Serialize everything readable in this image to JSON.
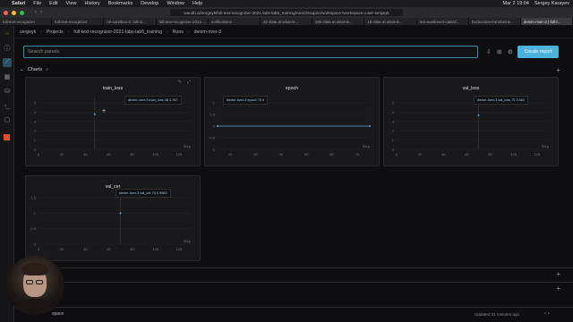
{
  "menubar": {
    "app": "Safari",
    "items": [
      "File",
      "Edit",
      "View",
      "History",
      "Bookmarks",
      "Develop",
      "Window",
      "Help"
    ],
    "clock": "Mar 2 19:04",
    "user": "Sergey Karayev"
  },
  "browser": {
    "url": "wandb.ai/sergeyk/full-text-recognizer-2021-labs-lab5_training/runs/3rxup2o/workspace?workspace=user-sergeyk",
    "tabs": [
      "full-text-recognizer",
      "full-text-recognizer",
      "ml-sandbox-2: full-to...",
      "full-text-recognizer-2021-...",
      "notifications",
      "23 slate at what-le...",
      "20k slate at what-le...",
      "15 slate at what-le...",
      "text-sentiment-classif..",
      "Exclusions-transforme...",
      "denim-river-3 | full-t..."
    ],
    "active_tab": 10
  },
  "breadcrumb": [
    "sergeyk",
    "Projects",
    "full-text-recognizer-2021-labs-lab5_training",
    "Runs",
    "denim-river-3"
  ],
  "search": {
    "placeholder": "Search panels"
  },
  "create_report": "Create report",
  "section": {
    "name": "Charts",
    "count": "4"
  },
  "panels": [
    {
      "title": "train_loss",
      "tooltip": "denim-river-3 train_loss 48  3.782",
      "xlabel": "Step",
      "xticks": [
        "0",
        "20",
        "40",
        "60",
        "80",
        "100",
        "120"
      ],
      "yticks": [
        "5",
        "4",
        "3",
        "2",
        "1",
        "0"
      ]
    },
    {
      "title": "epoch",
      "tooltip": "denim-river-3 epoch 70  0",
      "xlabel": "Step",
      "xticks": [
        "20",
        "30",
        "40",
        "50",
        "60",
        "70"
      ],
      "yticks": [
        "1",
        "0.5",
        "0",
        "-0.5",
        "-1"
      ]
    },
    {
      "title": "val_loss",
      "tooltip": "denim-river-3 val_loss 70  3.661",
      "xlabel": "Step",
      "xticks": [
        "0",
        "20",
        "40",
        "60",
        "80",
        "100",
        "120"
      ],
      "yticks": [
        "5",
        "4",
        "3",
        "2",
        "1",
        "0"
      ]
    },
    {
      "title": "val_cer",
      "tooltip": "denim-river-3 val_cer 70  0.9983",
      "xlabel": "Step",
      "xticks": [
        "0",
        "20",
        "40",
        "60",
        "80",
        "100",
        "120"
      ],
      "yticks": [
        "1.5",
        "1",
        "0.5",
        "0"
      ]
    }
  ],
  "chart_data": [
    {
      "type": "line",
      "title": "train_loss",
      "xlabel": "Step",
      "xlim": [
        0,
        130
      ],
      "ylim": [
        0,
        5
      ],
      "series": [
        {
          "name": "denim-river-3",
          "x": [
            48
          ],
          "y": [
            3.782
          ]
        }
      ]
    },
    {
      "type": "line",
      "title": "epoch",
      "xlabel": "Step",
      "xlim": [
        15,
        75
      ],
      "ylim": [
        -1,
        1
      ],
      "series": [
        {
          "name": "denim-river-3",
          "x": [
            15,
            75
          ],
          "y": [
            0,
            0
          ]
        }
      ]
    },
    {
      "type": "line",
      "title": "val_loss",
      "xlabel": "Step",
      "xlim": [
        0,
        130
      ],
      "ylim": [
        0,
        5
      ],
      "series": [
        {
          "name": "denim-river-3",
          "x": [
            70
          ],
          "y": [
            3.661
          ]
        }
      ]
    },
    {
      "type": "line",
      "title": "val_cer",
      "xlabel": "Step",
      "xlim": [
        0,
        130
      ],
      "ylim": [
        0,
        1.5
      ],
      "series": [
        {
          "name": "denim-river-3",
          "x": [
            70
          ],
          "y": [
            0.9983
          ]
        }
      ]
    }
  ],
  "footer": {
    "updated": "Updated 31 minutes ago",
    "workspace": "space"
  },
  "colors": {
    "accent": "#4bb3d9",
    "series": "#5fa8e0"
  }
}
